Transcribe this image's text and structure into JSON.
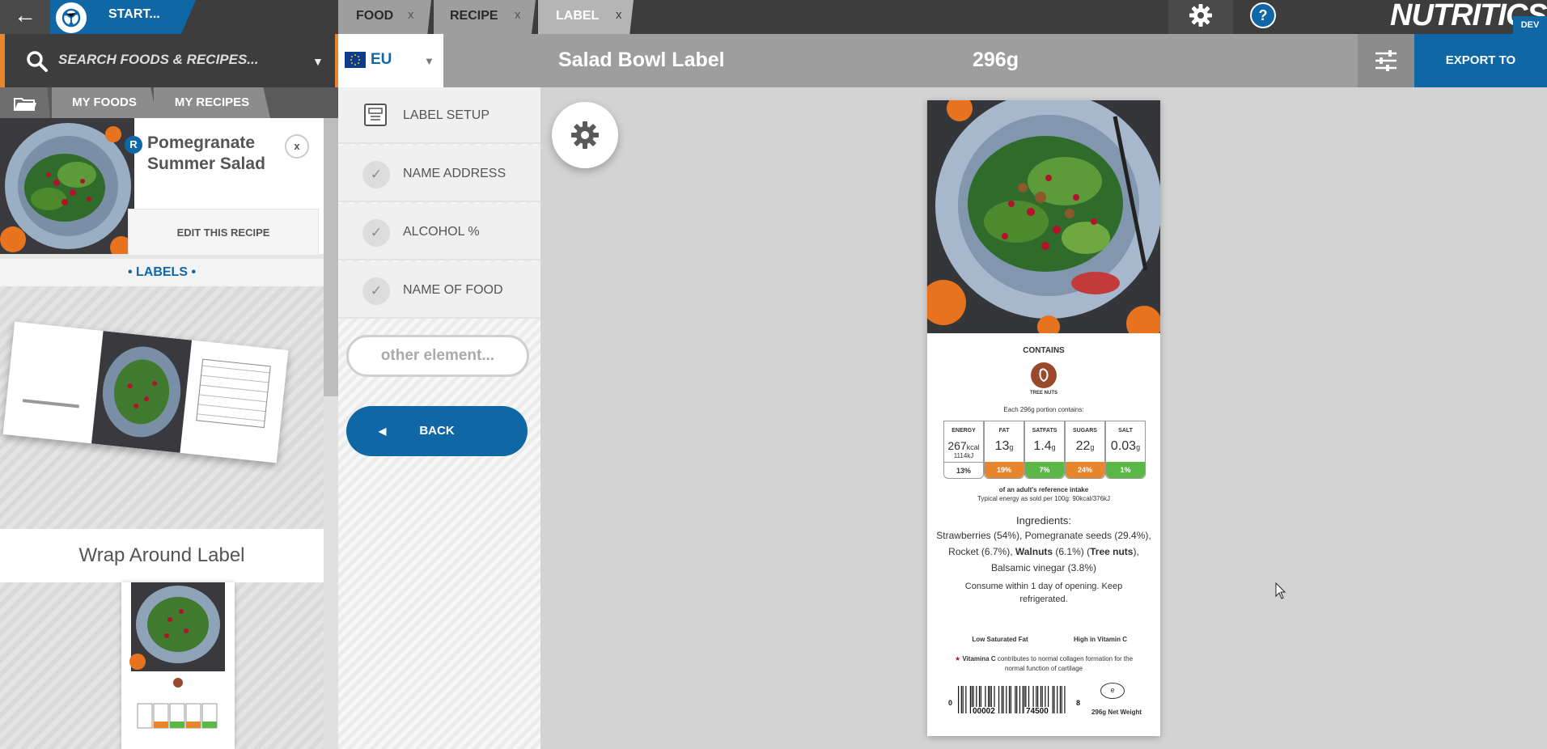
{
  "topbar": {
    "start_label": "START...",
    "tabs": [
      {
        "label": "FOOD",
        "close": "x"
      },
      {
        "label": "RECIPE",
        "close": "x"
      },
      {
        "label": "LABEL",
        "close": "x"
      }
    ],
    "help": "?",
    "logo": "NUTRITICS",
    "env_badge": "DEV"
  },
  "search": {
    "placeholder": "SEARCH FOODS & RECIPES..."
  },
  "region": {
    "label": "EU"
  },
  "label_header": {
    "title": "Salad Bowl Label",
    "weight": "296g",
    "export": "EXPORT TO"
  },
  "left_tabs": {
    "my_foods": "MY FOODS",
    "my_recipes": "MY RECIPES"
  },
  "recipe": {
    "badge": "R",
    "name": "Pomegranate Summer Salad",
    "close": "x",
    "edit": "EDIT THIS RECIPE"
  },
  "labels": {
    "heading": "• LABELS •",
    "item1": "Wrap Around Label"
  },
  "menu": {
    "setup": "LABEL SETUP",
    "items": [
      "NAME ADDRESS",
      "ALCOHOL %",
      "NAME OF FOOD"
    ],
    "other": "other element...",
    "back": "BACK"
  },
  "label": {
    "contains": "CONTAINS",
    "allergen": "TREE NUTS",
    "portion_note": "Each 296g portion contains:",
    "nutrients": [
      {
        "name": "ENERGY",
        "value": "267",
        "unit": "kcal",
        "sub": "1114kJ",
        "pct": "13%",
        "color": "#ffffff"
      },
      {
        "name": "FAT",
        "value": "13",
        "unit": "g",
        "pct": "19%",
        "color": "#e8862e"
      },
      {
        "name": "SATFATS",
        "value": "1.4",
        "unit": "g",
        "pct": "7%",
        "color": "#5cb846"
      },
      {
        "name": "SUGARS",
        "value": "22",
        "unit": "g",
        "pct": "24%",
        "color": "#e8862e"
      },
      {
        "name": "SALT",
        "value": "0.03",
        "unit": "g",
        "pct": "1%",
        "color": "#5cb846"
      }
    ],
    "ri_note": "of an adult's reference intake",
    "typical_note": "Typical energy as sold per 100g: 90kcal/376kJ",
    "ingredients_title": "Ingredients:",
    "ingredients_line1": "Strawberries (54%), Pomegranate seeds (29.4%),",
    "ingredients_line2_a": "Rocket (6.7%), ",
    "ingredients_line2_b": "Walnuts",
    "ingredients_line2_c": " (6.1%) (",
    "ingredients_line2_d": "Tree nuts",
    "ingredients_line2_e": "),",
    "ingredients_line3": "Balsamic vinegar (3.8%)",
    "storage_line1": "Consume within 1 day of opening. Keep",
    "storage_line2": "refrigerated.",
    "claim1": "Low Saturated Fat",
    "claim2": "High in Vitamin C",
    "vitc_star": "★",
    "vitc_bold": "Vitamina C",
    "vitc_rest": " contributes to normal collagen formation for the",
    "vitc_line2": "normal function of cartilage",
    "barcode_left": "0",
    "barcode_a": "00002",
    "barcode_b": "74500",
    "barcode_right": "8",
    "estimated_mark": "e",
    "net_weight": "296g Net Weight"
  },
  "colors": {
    "brand_blue": "#0f67a6",
    "accent_orange": "#e8862e",
    "green": "#5cb846",
    "allergen_brown": "#9a4a2c"
  }
}
